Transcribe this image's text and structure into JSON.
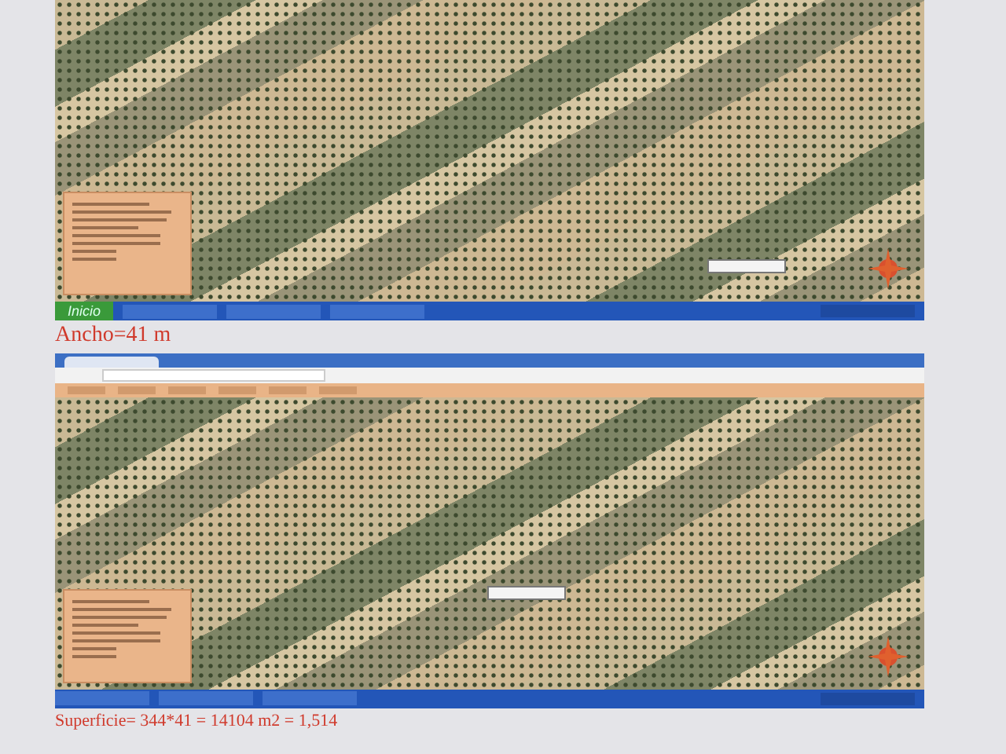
{
  "sections": [
    {
      "kind": "desktop_screenshot",
      "start_button": "Inicio"
    },
    {
      "kind": "caption",
      "text": "Ancho=41 m"
    },
    {
      "kind": "browser_screenshot"
    },
    {
      "kind": "caption",
      "text": "Superficie= 344*41 = 14104 m2 = 1,514"
    }
  ]
}
